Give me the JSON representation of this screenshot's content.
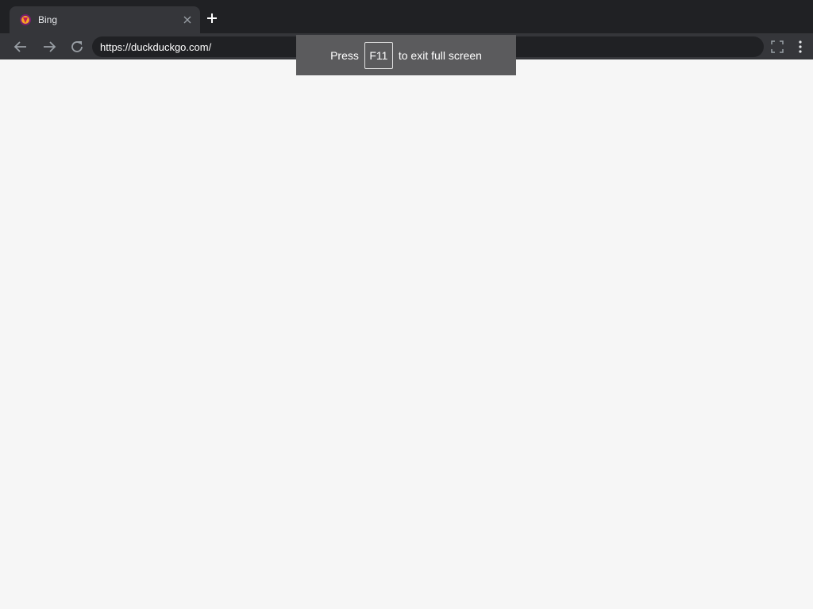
{
  "browser": {
    "tab": {
      "title": "Bing",
      "favicon": "bing-favicon-icon",
      "close_icon": "close-icon"
    },
    "new_tab_icon": "plus-icon",
    "toolbar": {
      "back_icon": "arrow-left-icon",
      "forward_icon": "arrow-right-icon",
      "reload_icon": "reload-icon",
      "url": "https://duckduckgo.com/",
      "fullscreen_icon": "fullscreen-icon",
      "menu_icon": "vertical-dots-icon"
    }
  },
  "fullscreen_notice": {
    "prefix": "Press",
    "key": "F11",
    "suffix": "to exit full screen"
  },
  "colors": {
    "tabstrip": "#202124",
    "toolbar": "#35363a",
    "page_background": "#f6f6f6",
    "notice_background": "#5b5b5d"
  }
}
